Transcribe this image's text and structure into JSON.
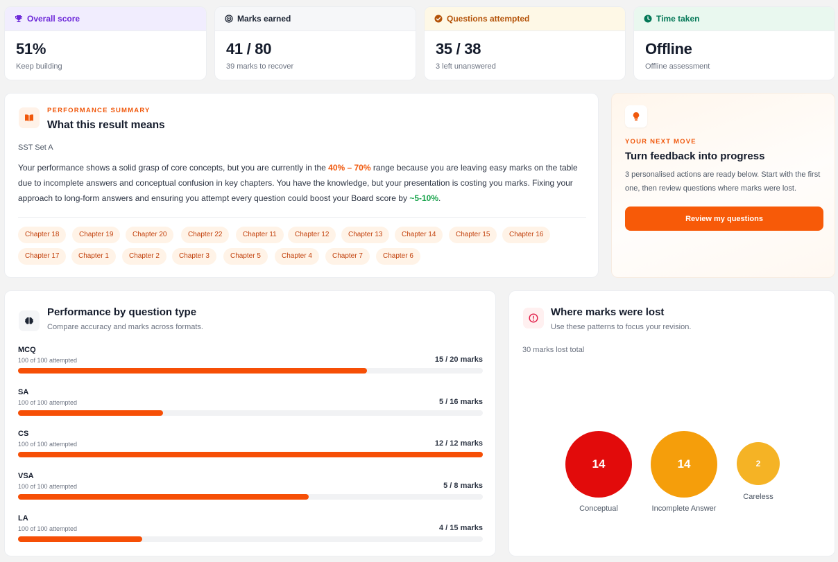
{
  "stats": [
    {
      "title": "Overall score",
      "value": "51%",
      "sub": "Keep building",
      "icon": "trophy-icon",
      "color": "#6d28d9",
      "bg": "#f1edfe"
    },
    {
      "title": "Marks earned",
      "value": "41 / 80",
      "sub": "39 marks to recover",
      "icon": "target-icon",
      "color": "#1c2433",
      "bg": "#f6f7f9"
    },
    {
      "title": "Questions attempted",
      "value": "35 / 38",
      "sub": "3 left unanswered",
      "icon": "check-circle-icon",
      "color": "#b45309",
      "bg": "#fef8e6"
    },
    {
      "title": "Time taken",
      "value": "Offline",
      "sub": "Offline assessment",
      "icon": "clock-icon",
      "color": "#047857",
      "bg": "#e9f8ef"
    }
  ],
  "summary": {
    "eyebrow": "PERFORMANCE SUMMARY",
    "title": "What this result means",
    "set": "SST Set A",
    "p1": "Your performance shows a solid grasp of core concepts, but you are currently in the ",
    "range": "40% – 70%",
    "p2": " range because you are leaving easy marks on the table due to incomplete answers and conceptual confusion in key chapters. You have the knowledge, but your presentation is costing you marks. Fixing your approach to long-form answers and ensuring you attempt every question could boost your Board score by ",
    "boost": "~5-10%",
    "p3": ".",
    "chapters_row1": [
      "Chapter 18",
      "Chapter 19",
      "Chapter 20",
      "Chapter 22",
      "Chapter 11",
      "Chapter 12",
      "Chapter 13",
      "Chapter 14",
      "Chapter 15",
      "Chapter 16"
    ],
    "chapters_row2": [
      "Chapter 17",
      "Chapter 1",
      "Chapter 2",
      "Chapter 3",
      "Chapter 5",
      "Chapter 4",
      "Chapter 7",
      "Chapter 6"
    ]
  },
  "next": {
    "eyebrow": "YOUR NEXT MOVE",
    "title": "Turn feedback into progress",
    "desc": "3 personalised actions are ready below. Start with the first one, then review questions where marks were lost.",
    "button": "Review my questions"
  },
  "qtype": {
    "title": "Performance by question type",
    "sub": "Compare accuracy and marks across formats.",
    "rows": [
      {
        "name": "MCQ",
        "attempted": "100 of 100 attempted",
        "marks": "15 / 20 marks",
        "fraction": 0.75
      },
      {
        "name": "SA",
        "attempted": "100 of 100 attempted",
        "marks": "5 / 16 marks",
        "fraction": 0.3125
      },
      {
        "name": "CS",
        "attempted": "100 of 100 attempted",
        "marks": "12 / 12 marks",
        "fraction": 1.0
      },
      {
        "name": "VSA",
        "attempted": "100 of 100 attempted",
        "marks": "5 / 8 marks",
        "fraction": 0.625
      },
      {
        "name": "LA",
        "attempted": "100 of 100 attempted",
        "marks": "4 / 15 marks",
        "fraction": 0.2667
      }
    ]
  },
  "lost": {
    "title": "Where marks were lost",
    "sub": "Use these patterns to focus your revision.",
    "total": "30 marks lost total",
    "bubbles": [
      {
        "label": "Conceptual",
        "value": "14",
        "color": "#e20b0b"
      },
      {
        "label": "Incomplete Answer",
        "value": "14",
        "color": "#f59e0b"
      },
      {
        "label": "Careless",
        "value": "2",
        "color": "#f5b325"
      }
    ]
  }
}
